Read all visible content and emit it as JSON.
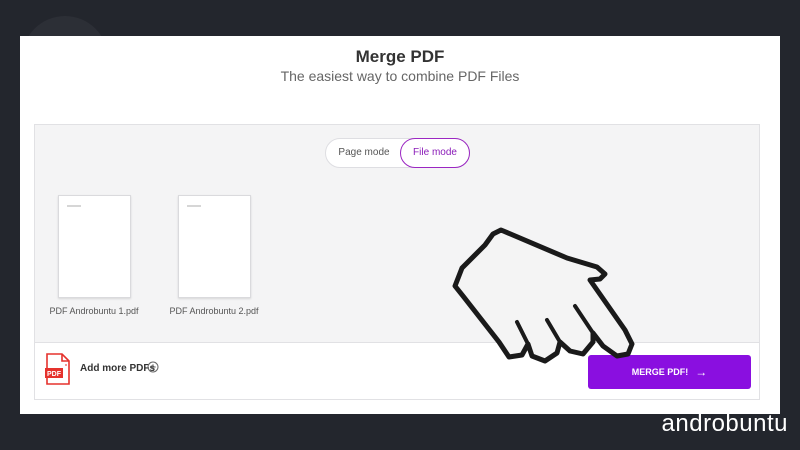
{
  "header": {
    "title": "Merge PDF",
    "subtitle": "The easiest way to combine PDF Files"
  },
  "modes": {
    "page_label": "Page mode",
    "file_label": "File mode",
    "selected": "File mode"
  },
  "files": [
    {
      "name": "PDF Androbuntu 1.pdf"
    },
    {
      "name": "PDF Androbuntu 2.pdf"
    }
  ],
  "footer": {
    "add_more_label": "Add more PDFs",
    "pdf_icon_label": "PDF",
    "merge_label": "MERGE PDF!",
    "merge_arrow": "→"
  },
  "watermark": "androbuntu",
  "colors": {
    "accent": "#8a0fe0",
    "toggle_active": "#9b27c2",
    "pdf_icon": "#e5322d",
    "background": "#23262d"
  },
  "icons": [
    "pdf-file-icon",
    "plus-circle-icon",
    "arrow-right-icon",
    "pointing-hand-icon"
  ]
}
